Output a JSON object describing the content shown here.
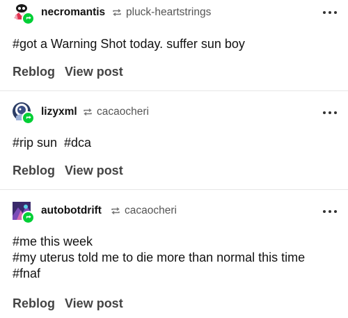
{
  "posts": [
    {
      "username": "necromantis",
      "source": "pluck-heartstrings",
      "lines": [
        "#got a Warning Shot today. suffer sun boy"
      ],
      "reblog_label": "Reblog",
      "view_label": "View post"
    },
    {
      "username": "lizyxml",
      "source": "cacaocheri",
      "lines": [
        "#rip sun  #dca"
      ],
      "reblog_label": "Reblog",
      "view_label": "View post"
    },
    {
      "username": "autobotdrift",
      "source": "cacaocheri",
      "lines": [
        "#me this week",
        "#my uterus told me to die more than normal this time",
        "#fnaf"
      ],
      "reblog_label": "Reblog",
      "view_label": "View post"
    }
  ],
  "colors": {
    "badge": "#00cf35",
    "divider": "#e6e6e6"
  },
  "icons": {
    "reblog": "reblog-icon",
    "more": "more-options-icon",
    "badge": "reblog-badge-icon"
  }
}
